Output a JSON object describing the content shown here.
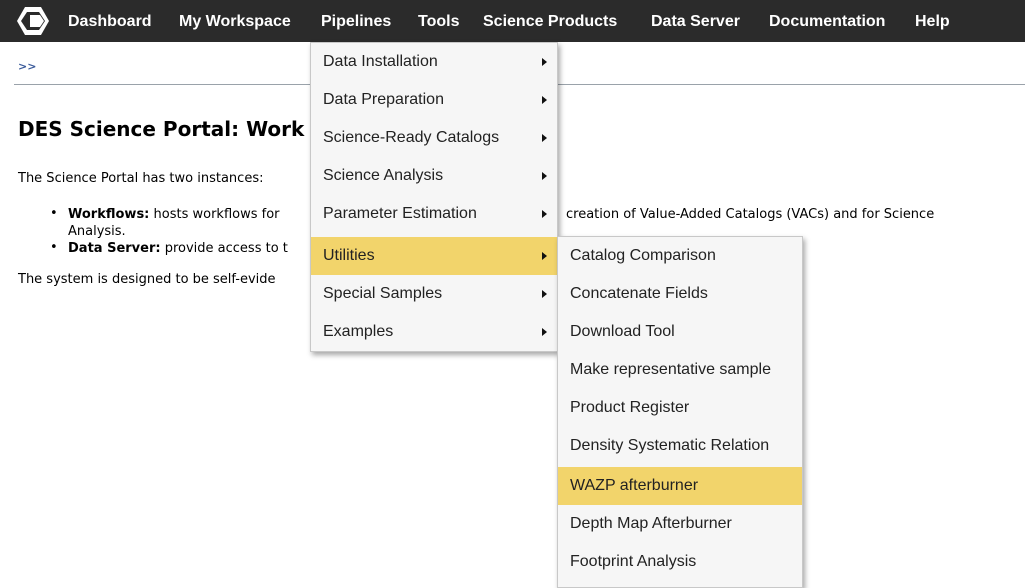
{
  "nav": {
    "logo_icon": "portal-logo-icon",
    "items": [
      "Dashboard",
      "My Workspace",
      "Pipelines",
      "Tools",
      "Science Products",
      "Data Server",
      "Documentation",
      "Help"
    ]
  },
  "breadcrumb": ">>",
  "content": {
    "title": "DES Science Portal: Work",
    "intro": "The Science Portal has two instances:",
    "bullets": [
      {
        "term": "Workflows:",
        "text_left": " hosts workflows for",
        "text_right": "creation of Value-Added Catalogs (VACs) and for Science",
        "continuation": "Analysis."
      },
      {
        "term": "Data Server:",
        "text_left": " provide access to t",
        "text_right": "",
        "continuation": ""
      }
    ],
    "closing": "The system is designed to be self-evide"
  },
  "pipelines_menu": {
    "items": [
      {
        "label": "Data Installation",
        "has_submenu": true
      },
      {
        "label": "Data Preparation",
        "has_submenu": true
      },
      {
        "label": "Science-Ready Catalogs",
        "has_submenu": true
      },
      {
        "label": "Science Analysis",
        "has_submenu": true
      },
      {
        "label": "Parameter Estimation",
        "has_submenu": true
      },
      {
        "label": "Utilities",
        "has_submenu": true,
        "highlighted": true
      },
      {
        "label": "Special Samples",
        "has_submenu": true
      },
      {
        "label": "Examples",
        "has_submenu": true
      }
    ]
  },
  "utilities_submenu": {
    "items": [
      {
        "label": "Catalog Comparison"
      },
      {
        "label": "Concatenate Fields"
      },
      {
        "label": "Download Tool"
      },
      {
        "label": "Make representative sample"
      },
      {
        "label": "Product Register"
      },
      {
        "label": "Density Systematic Relation"
      },
      {
        "label": "WAZP afterburner",
        "highlighted": true
      },
      {
        "label": "Depth Map Afterburner"
      },
      {
        "label": "Footprint Analysis"
      }
    ]
  },
  "colors": {
    "navbar_bg": "#2b2b2b",
    "menu_bg": "#f6f6f6",
    "highlight": "#f2d46b"
  }
}
